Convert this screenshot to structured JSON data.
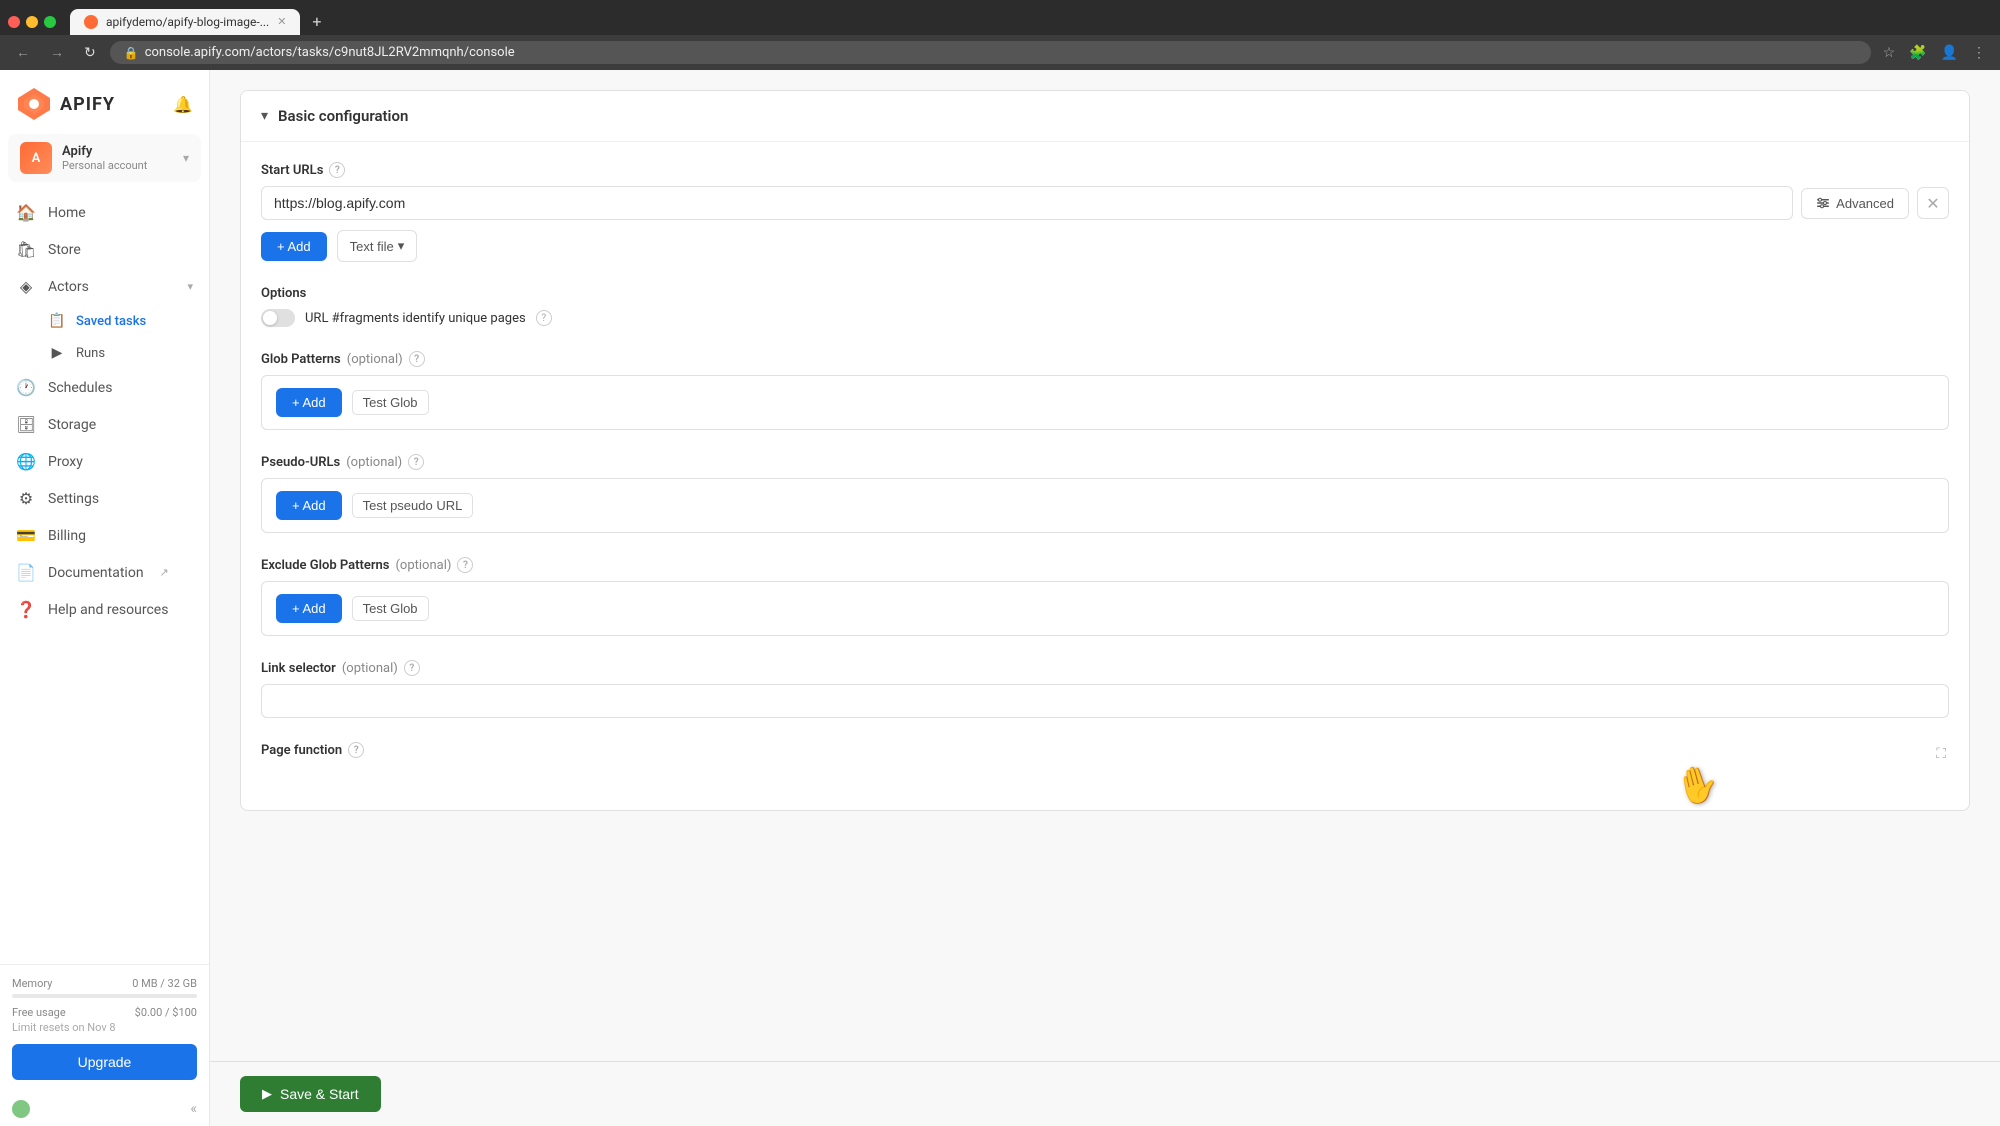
{
  "browser": {
    "tab_label": "apifydemo/apify-blog-image-...",
    "address": "console.apify.com/actors/tasks/c9nut8JL2RV2mmqnh/console",
    "new_tab_label": "+"
  },
  "sidebar": {
    "logo_text": "APIFY",
    "user": {
      "name": "Apify",
      "type": "Personal account",
      "initials": "A"
    },
    "nav_items": [
      {
        "id": "home",
        "label": "Home",
        "icon": "🏠"
      },
      {
        "id": "store",
        "label": "Store",
        "icon": "🛍"
      },
      {
        "id": "actors",
        "label": "Actors",
        "icon": "◈",
        "has_chevron": true,
        "expanded": true
      },
      {
        "id": "saved-tasks",
        "label": "Saved tasks",
        "icon": "📋",
        "sub": true
      },
      {
        "id": "runs",
        "label": "Runs",
        "icon": "▶",
        "sub": true
      },
      {
        "id": "schedules",
        "label": "Schedules",
        "icon": "🕐"
      },
      {
        "id": "storage",
        "label": "Storage",
        "icon": "🗄"
      },
      {
        "id": "proxy",
        "label": "Proxy",
        "icon": "🌐"
      },
      {
        "id": "settings",
        "label": "Settings",
        "icon": "⚙"
      },
      {
        "id": "billing",
        "label": "Billing",
        "icon": "💳"
      },
      {
        "id": "documentation",
        "label": "Documentation",
        "icon": "📄",
        "external": true
      },
      {
        "id": "help",
        "label": "Help and resources",
        "icon": "❓"
      }
    ],
    "memory_label": "Memory",
    "memory_value": "0 MB / 32 GB",
    "free_usage_label": "Free usage",
    "free_usage_value": "$0.00 / $100",
    "limit_reset": "Limit resets on Nov 8",
    "upgrade_btn": "Upgrade",
    "collapse_icon": "«"
  },
  "config": {
    "section_title": "Basic configuration",
    "start_urls": {
      "label": "Start URLs",
      "value": "https://blog.apify.com",
      "advanced_btn": "Advanced",
      "add_btn": "+ Add",
      "text_file_btn": "Text file"
    },
    "options": {
      "label": "Options",
      "toggle_label": "URL #fragments identify unique pages",
      "toggle_on": false
    },
    "glob_patterns": {
      "label": "Glob Patterns",
      "optional": "(optional)",
      "add_btn": "+ Add",
      "test_btn": "Test Glob"
    },
    "pseudo_urls": {
      "label": "Pseudo-URLs",
      "optional": "(optional)",
      "add_btn": "+ Add",
      "test_btn": "Test pseudo URL"
    },
    "exclude_glob": {
      "label": "Exclude Glob Patterns",
      "optional": "(optional)",
      "add_btn": "+ Add",
      "test_btn": "Test Glob"
    },
    "link_selector": {
      "label": "Link selector",
      "optional": "(optional)",
      "placeholder": ""
    },
    "page_function": {
      "label": "Page function"
    }
  },
  "bottom_bar": {
    "save_start_btn": "Save & Start"
  }
}
